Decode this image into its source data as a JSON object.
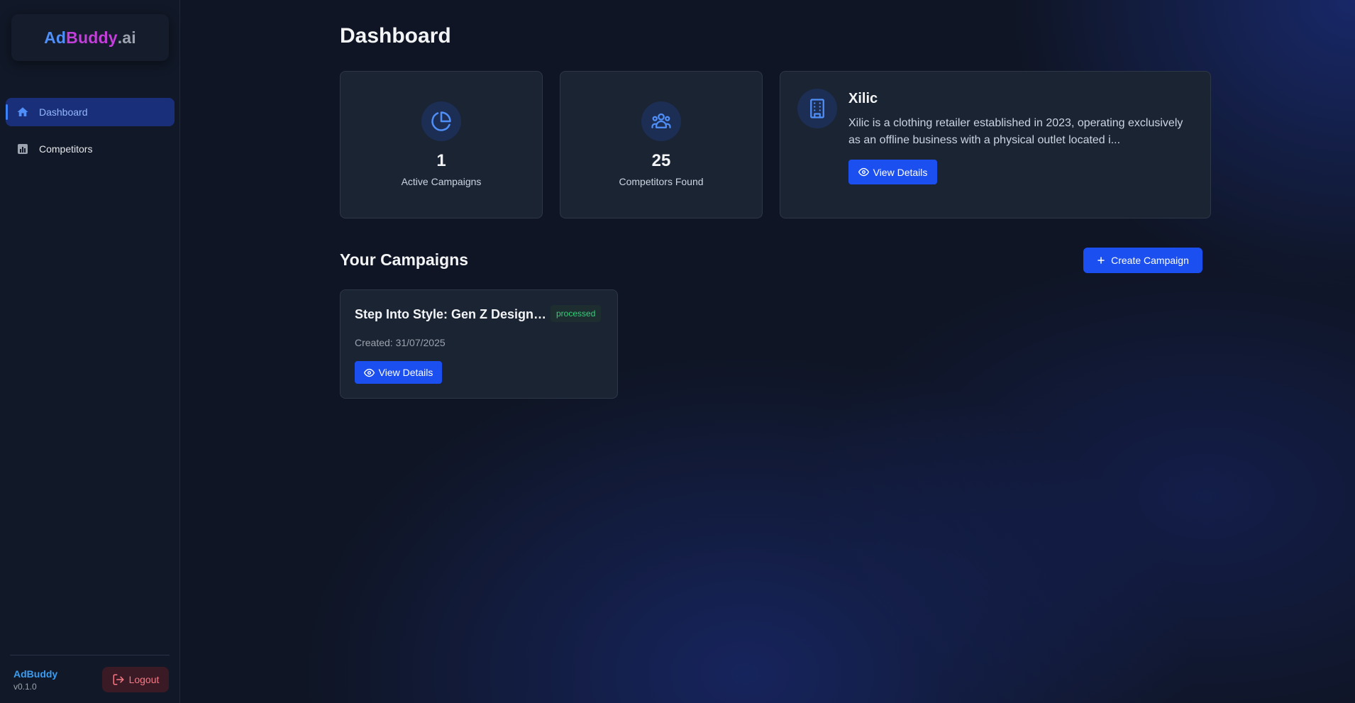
{
  "sidebar": {
    "logo": {
      "part1": "Ad",
      "part2": "Buddy",
      "part3": ".ai"
    },
    "items": [
      {
        "label": "Dashboard",
        "icon": "home-icon",
        "active": true
      },
      {
        "label": "Competitors",
        "icon": "bar-chart-icon",
        "active": false
      }
    ],
    "footer": {
      "app_name": "AdBuddy",
      "version": "v0.1.0",
      "logout_label": "Logout"
    }
  },
  "main": {
    "title": "Dashboard",
    "stats": [
      {
        "value": "1",
        "label": "Active Campaigns",
        "icon": "pie-chart-icon"
      },
      {
        "value": "25",
        "label": "Competitors Found",
        "icon": "users-icon"
      }
    ],
    "company": {
      "icon": "building-icon",
      "name": "Xilic",
      "description": "Xilic is a clothing retailer established in 2023, operating exclusively as an offline business with a physical outlet located i...",
      "button_label": "View Details"
    },
    "campaigns_section": {
      "title": "Your Campaigns",
      "create_label": "Create Campaign",
      "items": [
        {
          "title": "Step Into Style: Gen Z Designer...",
          "status": "processed",
          "created": "Created: 31/07/2025",
          "button_label": "View Details"
        }
      ]
    }
  },
  "colors": {
    "accent": "#1c4ff0",
    "status_processed": "#34d17a",
    "logout": "#f47a86",
    "icon_blue": "#4f8ff7"
  }
}
